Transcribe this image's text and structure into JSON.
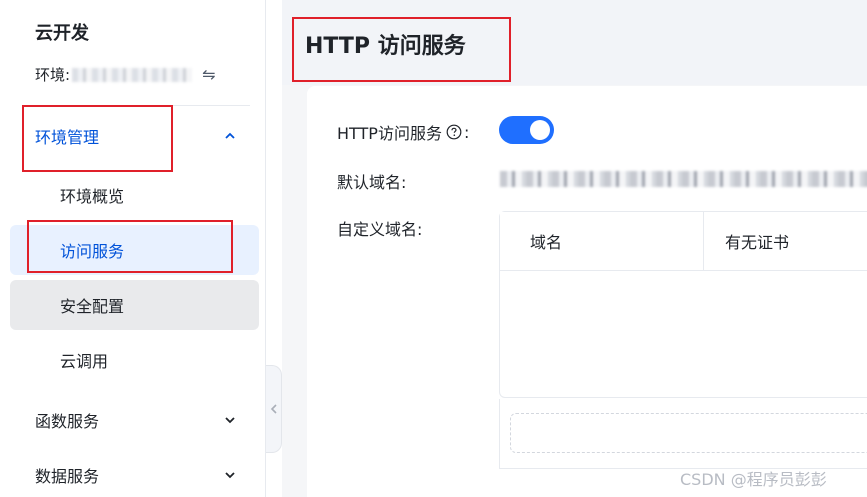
{
  "sidebar": {
    "app_title": "云开发",
    "env_label": "环境:",
    "groups": [
      {
        "label": "环境管理",
        "expanded": true,
        "items": [
          {
            "label": "环境概览"
          },
          {
            "label": "访问服务",
            "selected": true
          },
          {
            "label": "安全配置",
            "hovered": true
          },
          {
            "label": "云调用"
          }
        ]
      },
      {
        "label": "函数服务",
        "expanded": false
      },
      {
        "label": "数据服务",
        "expanded": false
      }
    ]
  },
  "main": {
    "title": "HTTP 访问服务",
    "http_service_label": "HTTP访问服务",
    "http_service_enabled": true,
    "default_domain_label": "默认域名:",
    "custom_domain_label": "自定义域名:",
    "table_headers": [
      "域名",
      "有无证书"
    ]
  },
  "watermark": "CSDN @程序员彭彭",
  "colors": {
    "accent": "#0052d9",
    "toggle_on": "#1f6fff",
    "highlight": "#e0202a",
    "selected_bg": "#e8f1ff"
  }
}
